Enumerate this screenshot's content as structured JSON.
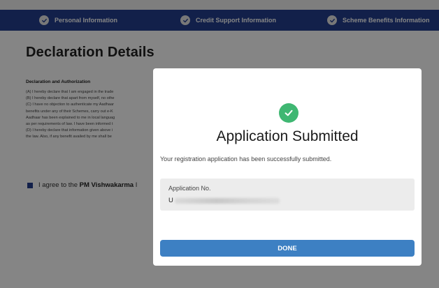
{
  "stepper": {
    "steps": [
      {
        "label": "Personal Information"
      },
      {
        "label": "Credit Support Information"
      },
      {
        "label": "Scheme Benefits Information"
      }
    ]
  },
  "page": {
    "title": "Declaration Details",
    "declaration_heading": "Declaration and Authorization",
    "lines": [
      "(A) I hereby declare that I am engaged in the trade",
      "(B) I hereby declare that apart from myself, no othe",
      "(C) I have no objection to authenticate my Aadhaar",
      "benefits under any of their Schemes, carry out e-K",
      "Aadhaar has been explained to me in local languag",
      "as per requirements of law. I have been informed t",
      "(D) I hereby declare that information given above i",
      "the law. Also, if any benefit availed by me shall be"
    ],
    "agree_text_prefix": "I agree to the ",
    "agree_text_bold": "PM Vishwakarma",
    "agree_text_suffix": " I"
  },
  "modal": {
    "title": "Application Submitted",
    "message": "Your registration application has been successfully submitted.",
    "app_no_label": "Application No.",
    "app_no_prefix": "U",
    "done_label": "DONE"
  },
  "colors": {
    "stepper_bg": "#233f8e",
    "success_green": "#3fb772",
    "done_button": "#3d80c3"
  }
}
